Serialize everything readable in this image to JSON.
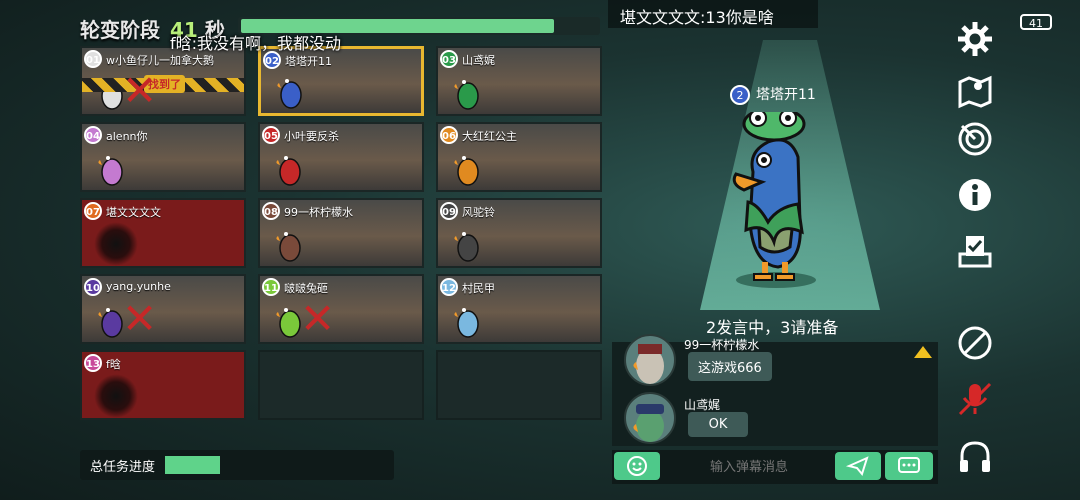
{
  "header": {
    "phase_label": "轮变阶段",
    "timer_value": "41",
    "timer_unit": "秒",
    "timer_progress": 0.88
  },
  "overlay_chat": "f晗:我没有啊，我都没动",
  "top_message": "堪文文文文:13你是啥",
  "battery": "41",
  "players": [
    {
      "num": "01",
      "name": "w小鱼仔儿一加拿大鹅",
      "state": "found",
      "badge_color": "#e0e0e0",
      "found_label": "找到了"
    },
    {
      "num": "02",
      "name": "塔塔开11",
      "state": "selected",
      "badge_color": "#3a5fc8"
    },
    {
      "num": "03",
      "name": "山鸢娓",
      "state": "alive",
      "badge_color": "#2a9a4a"
    },
    {
      "num": "04",
      "name": "alenn你",
      "state": "alive",
      "badge_color": "#c47ad0"
    },
    {
      "num": "05",
      "name": "小叶要反杀",
      "state": "alive",
      "badge_color": "#c62828"
    },
    {
      "num": "06",
      "name": "大红红公主",
      "state": "alive",
      "badge_color": "#e08a20"
    },
    {
      "num": "07",
      "name": "堪文文文文",
      "state": "dead",
      "badge_color": "#e06a20"
    },
    {
      "num": "08",
      "name": "99一杯柠檬水",
      "state": "alive",
      "badge_color": "#7a4a3a"
    },
    {
      "num": "09",
      "name": "风驼铃",
      "state": "alive",
      "badge_color": "#444444"
    },
    {
      "num": "10",
      "name": "yang.yunhe",
      "state": "eliminated",
      "badge_color": "#5a3aa0"
    },
    {
      "num": "11",
      "name": "啵啵兔砸",
      "state": "eliminated",
      "badge_color": "#7ac83a"
    },
    {
      "num": "12",
      "name": "村民甲",
      "state": "alive",
      "badge_color": "#7ab8e0"
    },
    {
      "num": "13",
      "name": "f晗",
      "state": "dead",
      "badge_color": "#c84a9a"
    }
  ],
  "task_progress": {
    "label": "总任务进度",
    "value": 0.24
  },
  "spotlight": {
    "num": "2",
    "name": "塔塔开11"
  },
  "speaking_status": "2发言中，3请准备",
  "chat": [
    {
      "name": "99一杯柠檬水",
      "message": "这游戏666"
    },
    {
      "name": "山鸢娓",
      "message": "OK"
    }
  ],
  "input": {
    "placeholder": "输入弹幕消息"
  },
  "icons": [
    "gear-icon",
    "map-icon",
    "radar-icon",
    "info-icon",
    "vote-icon",
    "no-sound-icon",
    "mic-muted-icon",
    "headphones-icon"
  ]
}
